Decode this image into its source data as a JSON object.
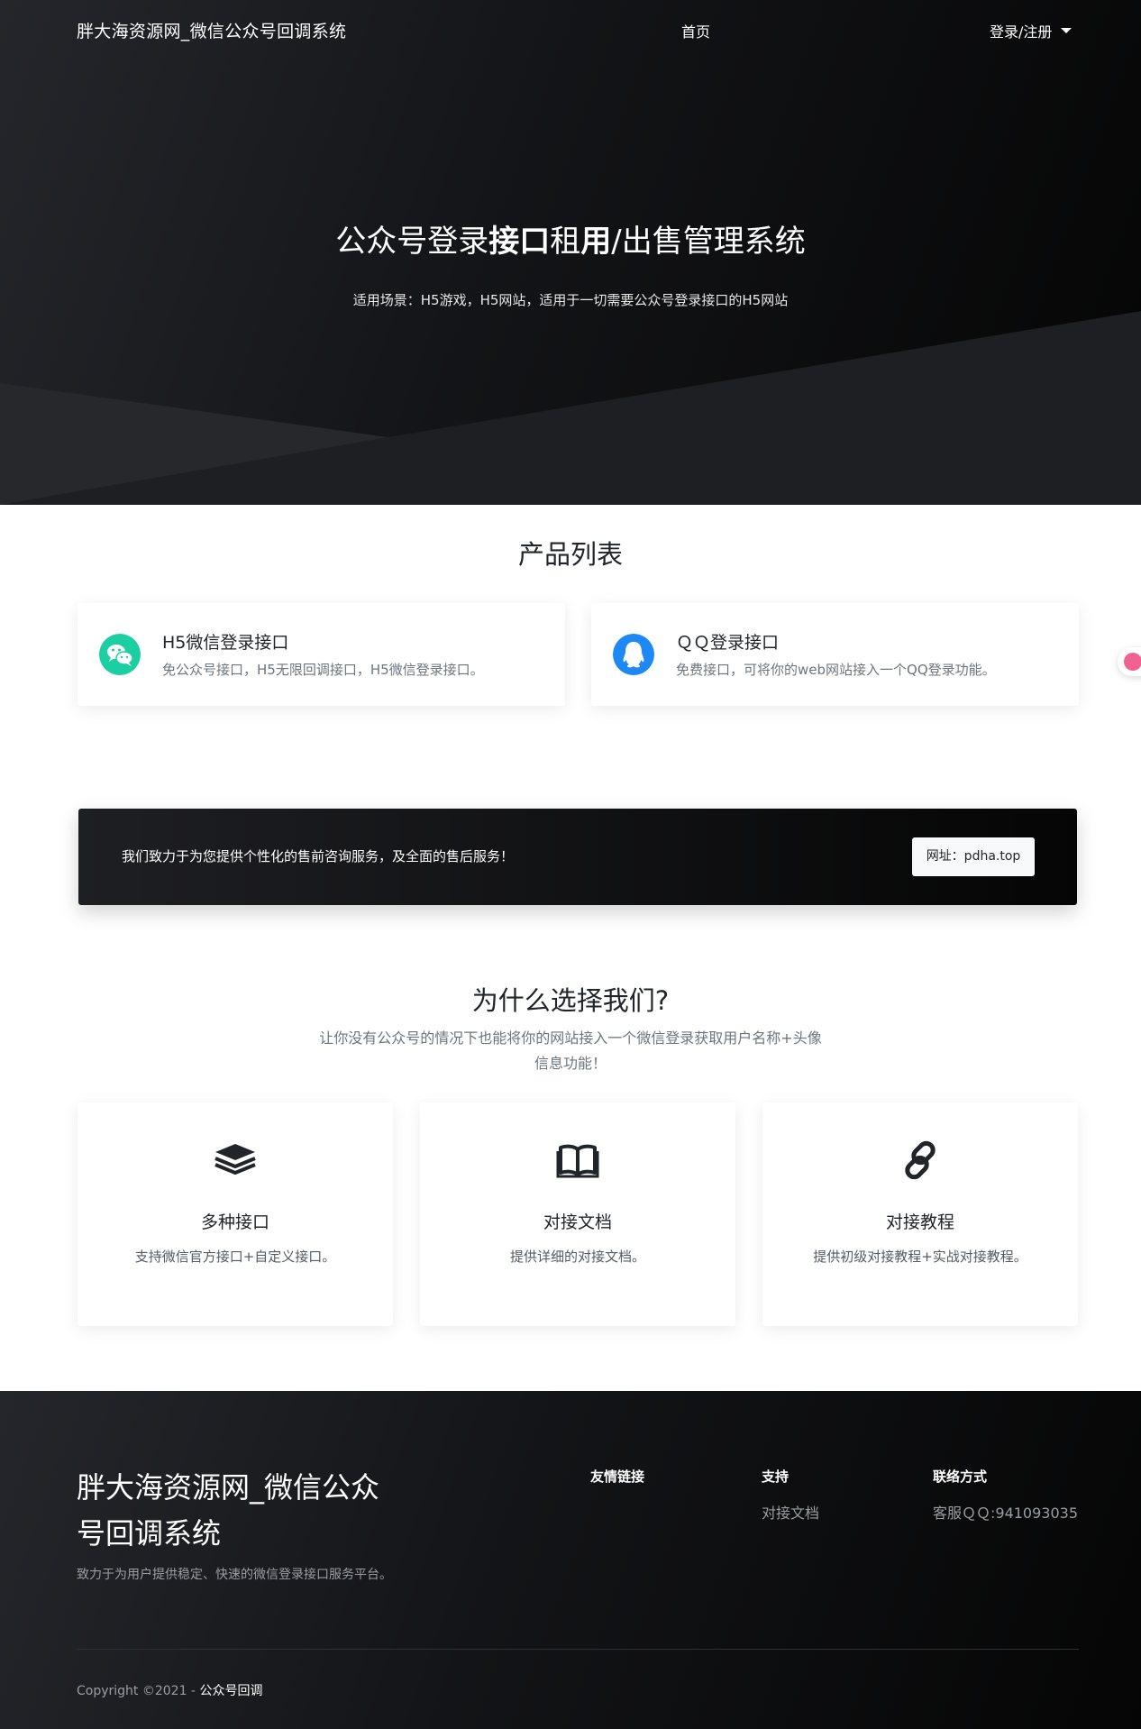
{
  "nav": {
    "brand": "胖大海资源网_微信公众号回调系统",
    "home": "首页",
    "login": "登录/注册"
  },
  "hero": {
    "title_part1": "公众号登录",
    "title_bold1": "接口",
    "title_part2": "租",
    "title_bold2": "用",
    "title_part3": "/出售管理系统",
    "subtitle": "适用场景：H5游戏，H5网站，适用于一切需要公众号登录接口的H5网站"
  },
  "products": {
    "title": "产品列表",
    "items": [
      {
        "name": "H5微信登录接口",
        "desc": "免公众号接口，H5无限回调接口，H5微信登录接口。",
        "icon": "wechat-icon",
        "color": "#1ccfa3"
      },
      {
        "name": "ＱＱ登录接口",
        "desc": "免费接口，可将你的web网站接入一个QQ登录功能。",
        "icon": "qq-icon",
        "color": "#1e88f5"
      }
    ]
  },
  "cta": {
    "text": "我们致力于为您提供个性化的售前咨询服务，及全面的售后服务！",
    "button": "网址：pdha.top"
  },
  "why": {
    "title": "为什么选择我们?",
    "subtitle": "让你没有公众号的情况下也能将你的网站接入一个微信登录获取用户名称+头像信息功能！",
    "features": [
      {
        "name": "多种接口",
        "desc": "支持微信官方接口+自定义接口。",
        "icon": "layers-icon"
      },
      {
        "name": "对接文档",
        "desc": "提供详细的对接文档。",
        "icon": "book-icon"
      },
      {
        "name": "对接教程",
        "desc": "提供初级对接教程+实战对接教程。",
        "icon": "link-icon"
      }
    ]
  },
  "footer": {
    "brand": "胖大海资源网_微信公众号回调系统",
    "tagline": "致力于为用户提供稳定、快速的微信登录接口服务平台。",
    "columns": [
      {
        "title": "友情链接",
        "items": []
      },
      {
        "title": "支持",
        "items": [
          "对接文档"
        ]
      },
      {
        "title": "联络方式",
        "items": [
          "客服ＱＱ:941093035"
        ]
      }
    ],
    "copyright_prefix": "Copyright ©2021 - ",
    "copyright_link": "公众号回调"
  }
}
